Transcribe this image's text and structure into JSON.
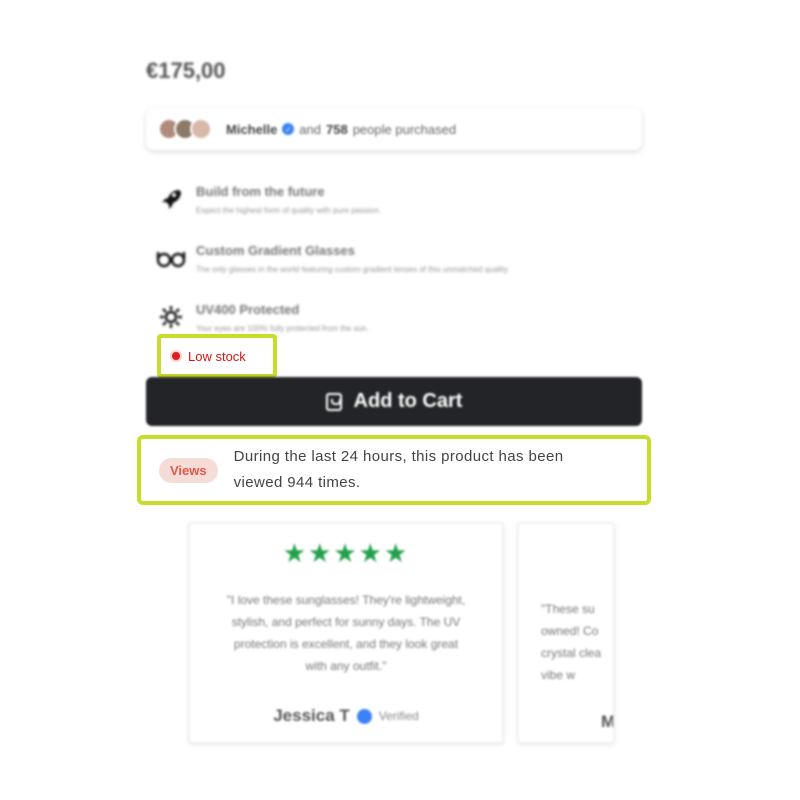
{
  "price": "€175,00",
  "social_proof": {
    "name": "Michelle",
    "middle": "and",
    "count": "758",
    "suffix": "people purchased"
  },
  "features": [
    {
      "icon": "rocket-icon",
      "title": "Build from the future",
      "desc": "Expect the highest form of quality with pure passion."
    },
    {
      "icon": "glasses-icon",
      "title": "Custom Gradient Glasses",
      "desc": "The only glasses in the world featuring custom gradient lenses of this unmatched quality."
    },
    {
      "icon": "sun-icon",
      "title": "UV400 Protected",
      "desc": "Your eyes are 100% fully protected from the sun."
    }
  ],
  "stock": {
    "label": "Low stock",
    "color": "#d41616"
  },
  "cart": {
    "label": "Add to Cart"
  },
  "views": {
    "badge": "Views",
    "line1": "During the last 24 hours, this product has been",
    "line2": "viewed 944 times."
  },
  "reviews": [
    {
      "stars": "★★★★★",
      "quote_lines": [
        "\"I love these sunglasses! They're lightweight,",
        "stylish, and perfect for sunny days. The UV",
        "protection is excellent, and they look great",
        "with any outfit.\""
      ],
      "name": "Jessica T",
      "verified": "Verified"
    },
    {
      "quote_lines": [
        "\"These su",
        "owned! Co",
        "crystal clea",
        "vibe w"
      ],
      "name": "M"
    }
  ],
  "colors": {
    "accent_highlight": "#c8dc2a",
    "button": "#232427",
    "star": "#22a04a",
    "badge_bg": "#f6dcd6",
    "badge_text": "#e0584a"
  }
}
